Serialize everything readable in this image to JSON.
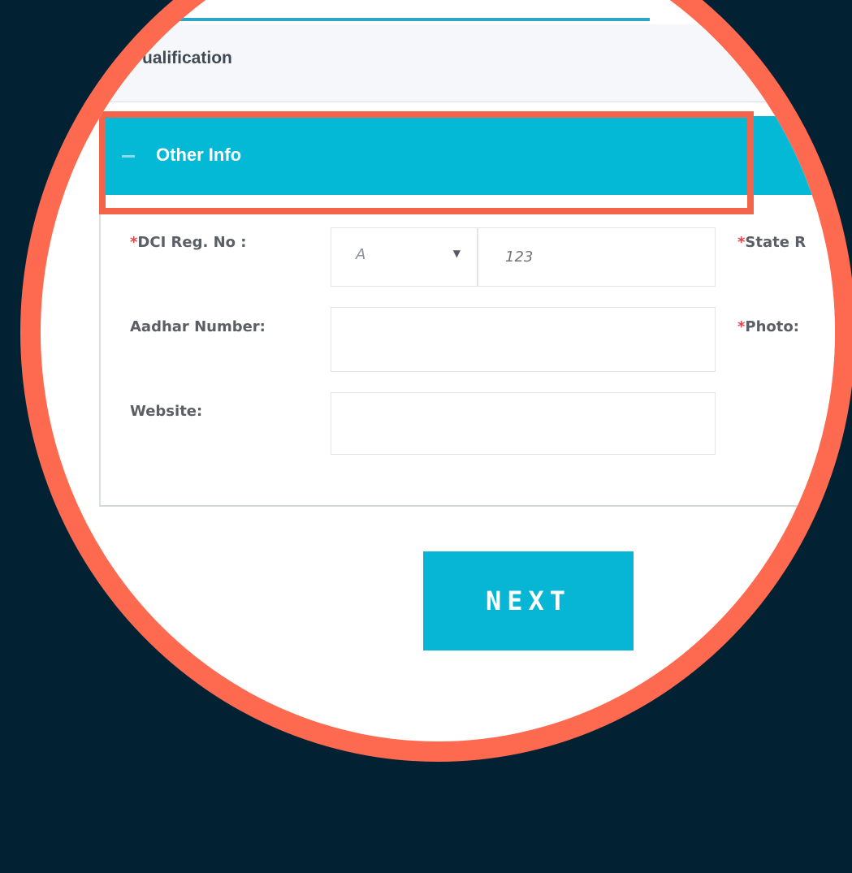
{
  "sections": {
    "qualification": {
      "label": "ualification"
    },
    "other_info": {
      "label": "Other Info"
    }
  },
  "form": {
    "dci_reg": {
      "required_mark": "*",
      "label": "DCI Reg. No :",
      "select_value": "A",
      "input_placeholder": "123"
    },
    "state_reg": {
      "required_mark": "*",
      "label": "State R"
    },
    "aadhar": {
      "label": "Aadhar Number:",
      "value": ""
    },
    "photo": {
      "required_mark": "*",
      "label": "Photo:"
    },
    "website": {
      "label": "Website:",
      "value": ""
    }
  },
  "buttons": {
    "next_label": "NEXT"
  },
  "colors": {
    "background": "#022234",
    "lens_ring": "#fe6a50",
    "accent": "#03b9d5",
    "highlight": "#f3644b",
    "required": "#e4454d"
  }
}
